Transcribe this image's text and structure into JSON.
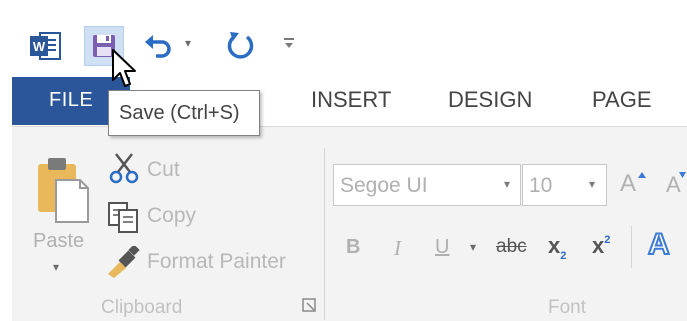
{
  "quick_access": {
    "app_icon": "word-icon",
    "save_icon": "save-icon",
    "undo_icon": "undo-icon",
    "redo_icon": "repeat-icon",
    "customize_icon": "customize-qat-icon"
  },
  "tabs": {
    "file": "FILE",
    "items": [
      "INSERT",
      "DESIGN",
      "PAGE"
    ]
  },
  "tooltip": {
    "text": "Save (Ctrl+S)"
  },
  "clipboard": {
    "paste": "Paste",
    "cut": "Cut",
    "copy": "Copy",
    "format_painter": "Format Painter",
    "group_label": "Clipboard"
  },
  "font": {
    "font_name": "Segoe UI",
    "font_size": "10",
    "bold": "B",
    "italic": "I",
    "underline": "U",
    "strikethrough": "abc",
    "subscript": "x",
    "subscript_mark": "2",
    "superscript": "x",
    "superscript_mark": "2",
    "grow_font": "A",
    "shrink_font": "A",
    "text_effects": "A",
    "group_label": "Font"
  },
  "colors": {
    "file_tab": "#2b579a",
    "word_blue": "#2b579a",
    "accent": "#3b7ad6",
    "save_highlight": "#cfe0f5"
  }
}
